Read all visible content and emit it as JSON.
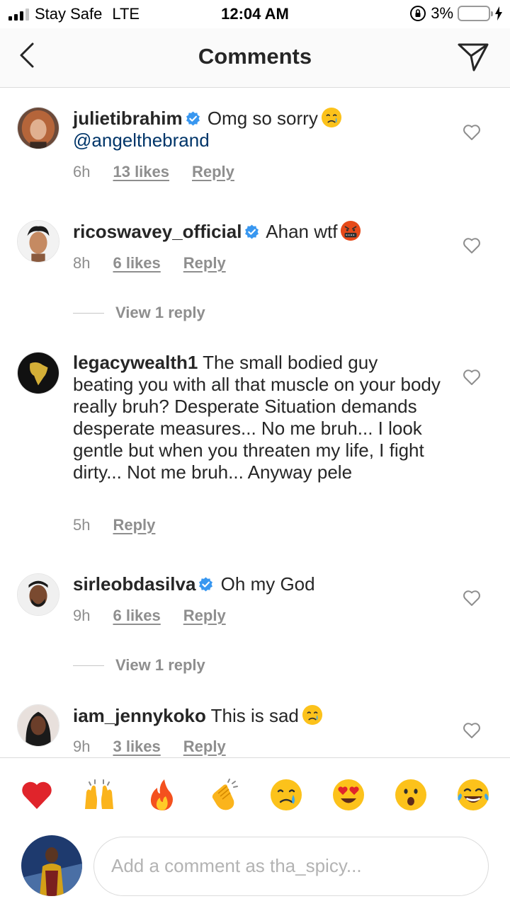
{
  "status_bar": {
    "carrier": "Stay Safe",
    "network": "LTE",
    "time": "12:04 AM",
    "battery_percent": "3%",
    "battery_level": 0.03
  },
  "header": {
    "title": "Comments"
  },
  "comments": [
    {
      "username": "julietibrahim",
      "verified": true,
      "text": "Omg so sorry",
      "emoji": "crying-face",
      "mention": "@angelthebrand",
      "time": "6h",
      "likes": "13 likes",
      "reply": "Reply"
    },
    {
      "username": "ricoswavey_official",
      "verified": true,
      "text": "Ahan wtf",
      "emoji": "cursing-face",
      "time": "8h",
      "likes": "6 likes",
      "reply": "Reply",
      "view_replies": "View 1 reply"
    },
    {
      "username": "legacywealth1",
      "verified": false,
      "text": "The small bodied guy beating you with all that muscle on your body really bruh? Desperate Situation demands desperate measures... No me bruh... I look gentle but when you threaten my life, I fight dirty... Not me bruh... Anyway pele",
      "time": "5h",
      "reply": "Reply"
    },
    {
      "username": "sirleobdasilva",
      "verified": true,
      "text": "Oh my God",
      "time": "9h",
      "likes": "6 likes",
      "reply": "Reply",
      "view_replies": "View 1 reply"
    },
    {
      "username": "iam_jennykoko",
      "verified": false,
      "text": "This is sad",
      "emoji": "crying-face",
      "time": "9h",
      "likes": "3 likes",
      "reply": "Reply"
    }
  ],
  "quick_reactions": [
    "red-heart",
    "raising-hands",
    "fire",
    "clapping-hands",
    "crying-face",
    "heart-eyes",
    "surprised-face",
    "tears-of-joy"
  ],
  "composer": {
    "placeholder": "Add a comment as tha_spicy..."
  },
  "colors": {
    "verified_blue": "#3897f0",
    "mention": "#003569",
    "meta_gray": "#8e8e8e"
  }
}
